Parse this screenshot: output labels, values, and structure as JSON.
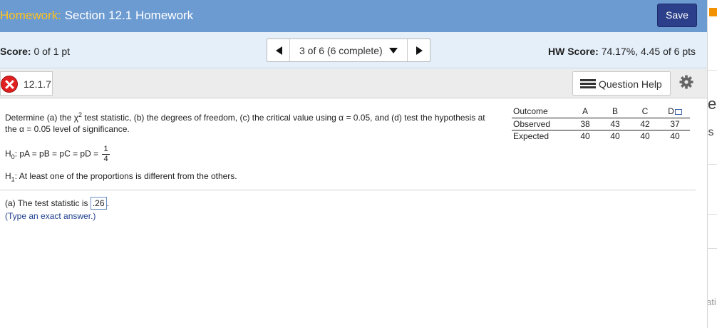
{
  "header": {
    "hw_label": "Homework:",
    "title": "Section 12.1 Homework",
    "save_label": "Save"
  },
  "scorebar": {
    "score_label": "Score:",
    "score_value": "0 of 1 pt",
    "progress": "3 of 6 (6 complete)",
    "hw_score_label": "HW Score:",
    "hw_score_value": "74.17%, 4.45 of 6 pts"
  },
  "question_bar": {
    "question_id": "12.1.7",
    "help_label": "Question Help"
  },
  "problem": {
    "text_a": "Determine (a) the χ",
    "sup": "2",
    "text_b": " test statistic, (b) the degrees of freedom, (c) the critical value using α = 0.05, and (d) test the hypothesis at the α = 0.05 level of significance.",
    "h0_text": "H",
    "h0_sub": "0",
    "h0_eq": ": p",
    "h0_rest": "A = pB = pC = pD =",
    "frac_num": "1",
    "frac_den": "4",
    "h1_text": "H",
    "h1_sub": "1",
    "h1_rest": ": At least one of the proportions is different from the others."
  },
  "table": {
    "headers": [
      "Outcome",
      "A",
      "B",
      "C",
      "D"
    ],
    "observed": [
      "Observed",
      "38",
      "43",
      "42",
      "37"
    ],
    "expected": [
      "Expected",
      "40",
      "40",
      "40",
      "40"
    ]
  },
  "answer": {
    "prefix": "(a) The test statistic is",
    "value": ".26",
    "suffix": ".",
    "hint": "(Type an exact answer.)"
  },
  "right_strip": {
    "frag1": "e",
    "frag2": "is",
    "frag3": "ati"
  },
  "colors": {
    "title_bar": "#6c9bd2",
    "hw_label": "#ffc21c",
    "save_button": "#2b3f8a",
    "score_bar": "#e5eff9",
    "incorrect": "#e02020",
    "hint": "#1f3f8f"
  }
}
